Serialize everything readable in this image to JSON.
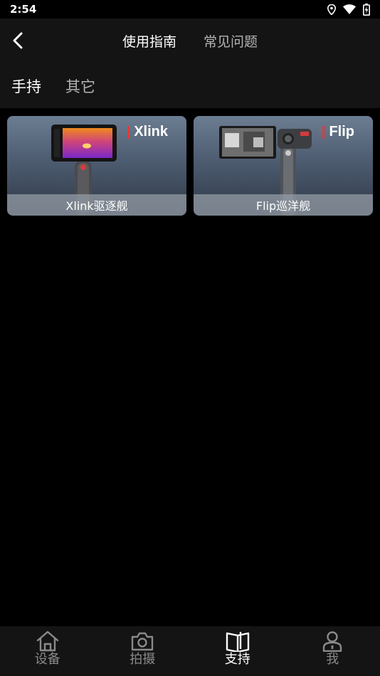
{
  "status_bar": {
    "time": "2:54",
    "icons": [
      "location-icon",
      "wifi-icon",
      "battery-icon"
    ]
  },
  "header": {
    "back_icon": "chevron-left-icon",
    "tabs": [
      {
        "label": "使用指南",
        "active": true
      },
      {
        "label": "常见问题",
        "active": false
      }
    ]
  },
  "categories": [
    {
      "label": "手持",
      "active": true
    },
    {
      "label": "其它",
      "active": false
    }
  ],
  "products": [
    {
      "brand": "Xlink",
      "label": "Xlink驱逐舰"
    },
    {
      "brand": "Flip",
      "label": "Flip巡洋舰"
    }
  ],
  "bottom_nav": [
    {
      "label": "设备",
      "icon": "home-icon",
      "active": false
    },
    {
      "label": "拍摄",
      "icon": "camera-icon",
      "active": false
    },
    {
      "label": "支持",
      "icon": "book-icon",
      "active": true
    },
    {
      "label": "我",
      "icon": "person-icon",
      "active": false
    }
  ],
  "colors": {
    "background": "#000000",
    "header_bg": "#141414",
    "brand_accent": "#e23a3a"
  }
}
